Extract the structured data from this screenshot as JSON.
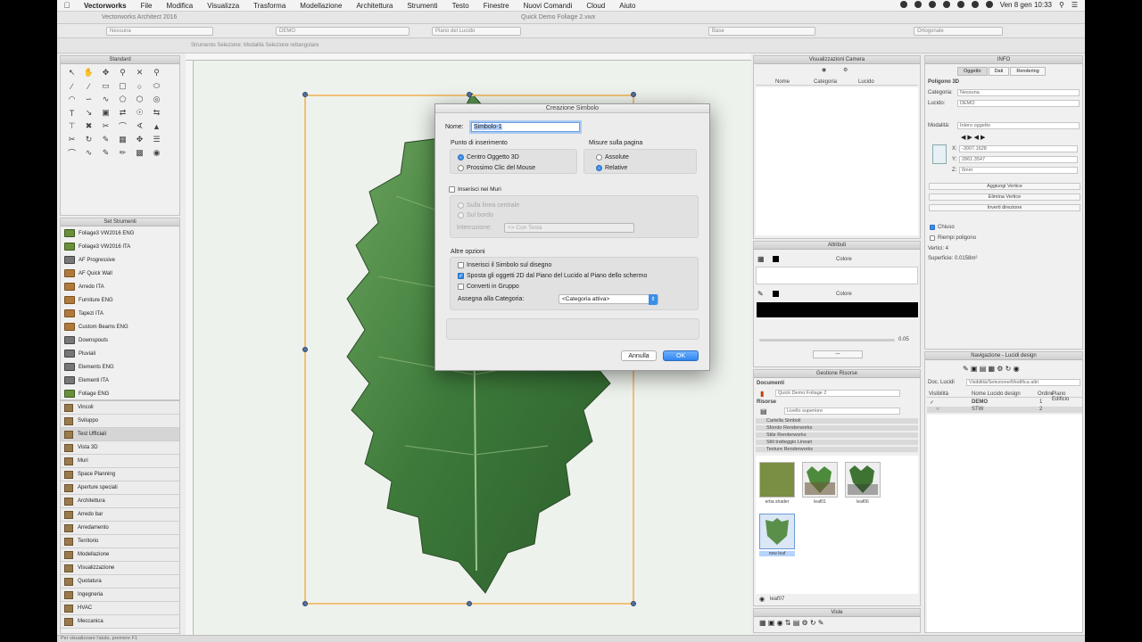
{
  "menubar": {
    "app": "Vectorworks",
    "items": [
      "File",
      "Modifica",
      "Visualizza",
      "Trasforma",
      "Modellazione",
      "Architettura",
      "Strumenti",
      "Testo",
      "Finestre",
      "Nuovi Comandi",
      "Cloud",
      "Aiuto"
    ],
    "clock": "Ven 8 gen  10:33"
  },
  "window": {
    "app_title": "Vectorworks Architect 2016",
    "doc_title": "Quick Demo Foliage 2.vwx"
  },
  "toolbar": {
    "class_field": "Nessuna",
    "layer_field": "DEMO",
    "plane_field": "Piano del Lucido",
    "view_field": "Base",
    "render_field": "Ortogonale"
  },
  "modebar": {
    "hint": "Strumento Selezione: Modalità Selezione rettangolare"
  },
  "palettes": {
    "standard_title": "Standard",
    "workspace_sets_title": "Set Strumenti",
    "workspace_sets": [
      {
        "label": "Foliage3 VW2016 ENG",
        "icon": "leaf-icon"
      },
      {
        "label": "Foliage3 VW2016 ITA",
        "icon": "leaf-icon"
      },
      {
        "label": "AF Progressive",
        "icon": "grid-icon"
      },
      {
        "label": "AF Quick Wall",
        "icon": "wall-icon"
      },
      {
        "label": "Arredo ITA",
        "icon": "furniture-icon"
      },
      {
        "label": "Furniture ENG",
        "icon": "furniture-icon"
      },
      {
        "label": "Tapezi ITA",
        "icon": "furniture-icon"
      },
      {
        "label": "Custom Beams ENG",
        "icon": "beam-icon"
      },
      {
        "label": "Downspouts",
        "icon": "pipe-icon"
      },
      {
        "label": "Pluviali",
        "icon": "pipe-icon"
      },
      {
        "label": "Elements ENG",
        "icon": "elements-icon"
      },
      {
        "label": "Elementi ITA",
        "icon": "elements-icon"
      },
      {
        "label": "Foliage ENG",
        "icon": "leaf-icon"
      }
    ],
    "tool_categories": [
      "Vincoli",
      "Sviluppo",
      "Test Ufficiali",
      "Vista 3D",
      "Muri",
      "Space Planning",
      "Aperture speciali",
      "Architettura",
      "Arredo bar",
      "Arredamento",
      "Territorio",
      "Modellazione",
      "Visualizzazione",
      "Quotatura",
      "Ingegneria",
      "HVAC",
      "Meccanica"
    ],
    "tool_categories_selected": "Test Ufficiali"
  },
  "dialog": {
    "title": "Creazione Simbolo",
    "name_label": "Nome:",
    "name_value": "Simbolo-1",
    "insertion_point": {
      "title": "Punto di inserimento",
      "options": [
        "Centro Oggetto 3D",
        "Prossimo Clic del Mouse"
      ],
      "selected": "Centro Oggetto 3D"
    },
    "page_units": {
      "title": "Misure sulla pagina",
      "options": [
        "Assolute",
        "Relative"
      ],
      "selected": "Relative"
    },
    "insert_in_walls": {
      "label": "Inserisci nei Muri",
      "checked": false,
      "sub_options": [
        "Sulla linea centrale",
        "Sul bordo"
      ],
      "break_label": "Interruzione:",
      "break_value": "<> Con Testa"
    },
    "other_options": {
      "title": "Altre opzioni",
      "items": [
        {
          "label": "Inserisci il Simbolo sul disegno",
          "checked": false
        },
        {
          "label": "Sposta gli oggetti 2D dal Piano del Lucido al Piano dello schermo",
          "checked": true
        },
        {
          "label": "Converti in Gruppo",
          "checked": false
        }
      ],
      "category_label": "Assegna alla Categoria:",
      "category_value": "<Categoria attiva>"
    },
    "buttons": {
      "cancel": "Annulla",
      "ok": "OK"
    }
  },
  "right_palettes": {
    "views_title": "Visualizzazioni Camera",
    "views_columns": [
      "Nome",
      "Categoria",
      "Lucido"
    ],
    "attributes_title": "Attributi",
    "attr_fill": "Colore",
    "attr_pen": "Colore",
    "attr_value": "0.05",
    "resource_title": "Gestione Risorse",
    "documents_label": "Documenti",
    "document_value": "Quick Demo Foliage 2",
    "resources_label": "Risorse",
    "resource_source": "Livello superiore",
    "resource_rows": [
      "Cartella Simboli",
      "Sfondo Renderworks",
      "Stile Renderworks",
      "Stili tratteggio Lineari",
      "Texture Renderworks"
    ],
    "thumbs": [
      {
        "label": "erba shader"
      },
      {
        "label": "leaf01"
      },
      {
        "label": "leaf06"
      },
      {
        "label": "new leaf"
      }
    ],
    "selected_resource": "leaf07",
    "views_footer_title": "Viste",
    "info_title": "INFO",
    "info_tabs": [
      "Oggetto",
      "Dati",
      "Rendering"
    ],
    "info_object": "Poligono 3D",
    "info_class_label": "Categoria:",
    "info_class_value": "Nessuna",
    "info_layer_label": "Lucido:",
    "info_layer_value": "DEMO",
    "info_mode_label": "Modalità:",
    "info_mode_value": "Intero oggetto",
    "info_x": "-3007.1628",
    "info_y": "2861.3547",
    "info_z": "0mm",
    "info_buttons": [
      "Aggiungi Vertice",
      "Elimina Vertice",
      "Inverti direzione"
    ],
    "info_closed": "Chiuso",
    "info_fill_label": "Riempi poligono",
    "info_vertices": "Vertici: 4",
    "info_area": "Superficie: 0.0158m²",
    "nav_title": "Navigazione - Lucidi design",
    "nav_layer_label": "Doc. Lucidi",
    "nav_layer_value": "Visibilità/Selezione/Modifica altri",
    "nav_columns": [
      "Visibilità",
      "Nome Lucido design",
      "Ordine",
      "Piano Edificio"
    ],
    "nav_rows": [
      {
        "name": "DEMO",
        "order": "1"
      },
      {
        "name": "STW",
        "order": "2"
      }
    ]
  },
  "statusbar": {
    "hint": "Per visualizzare l'aiuto, premere F1"
  }
}
